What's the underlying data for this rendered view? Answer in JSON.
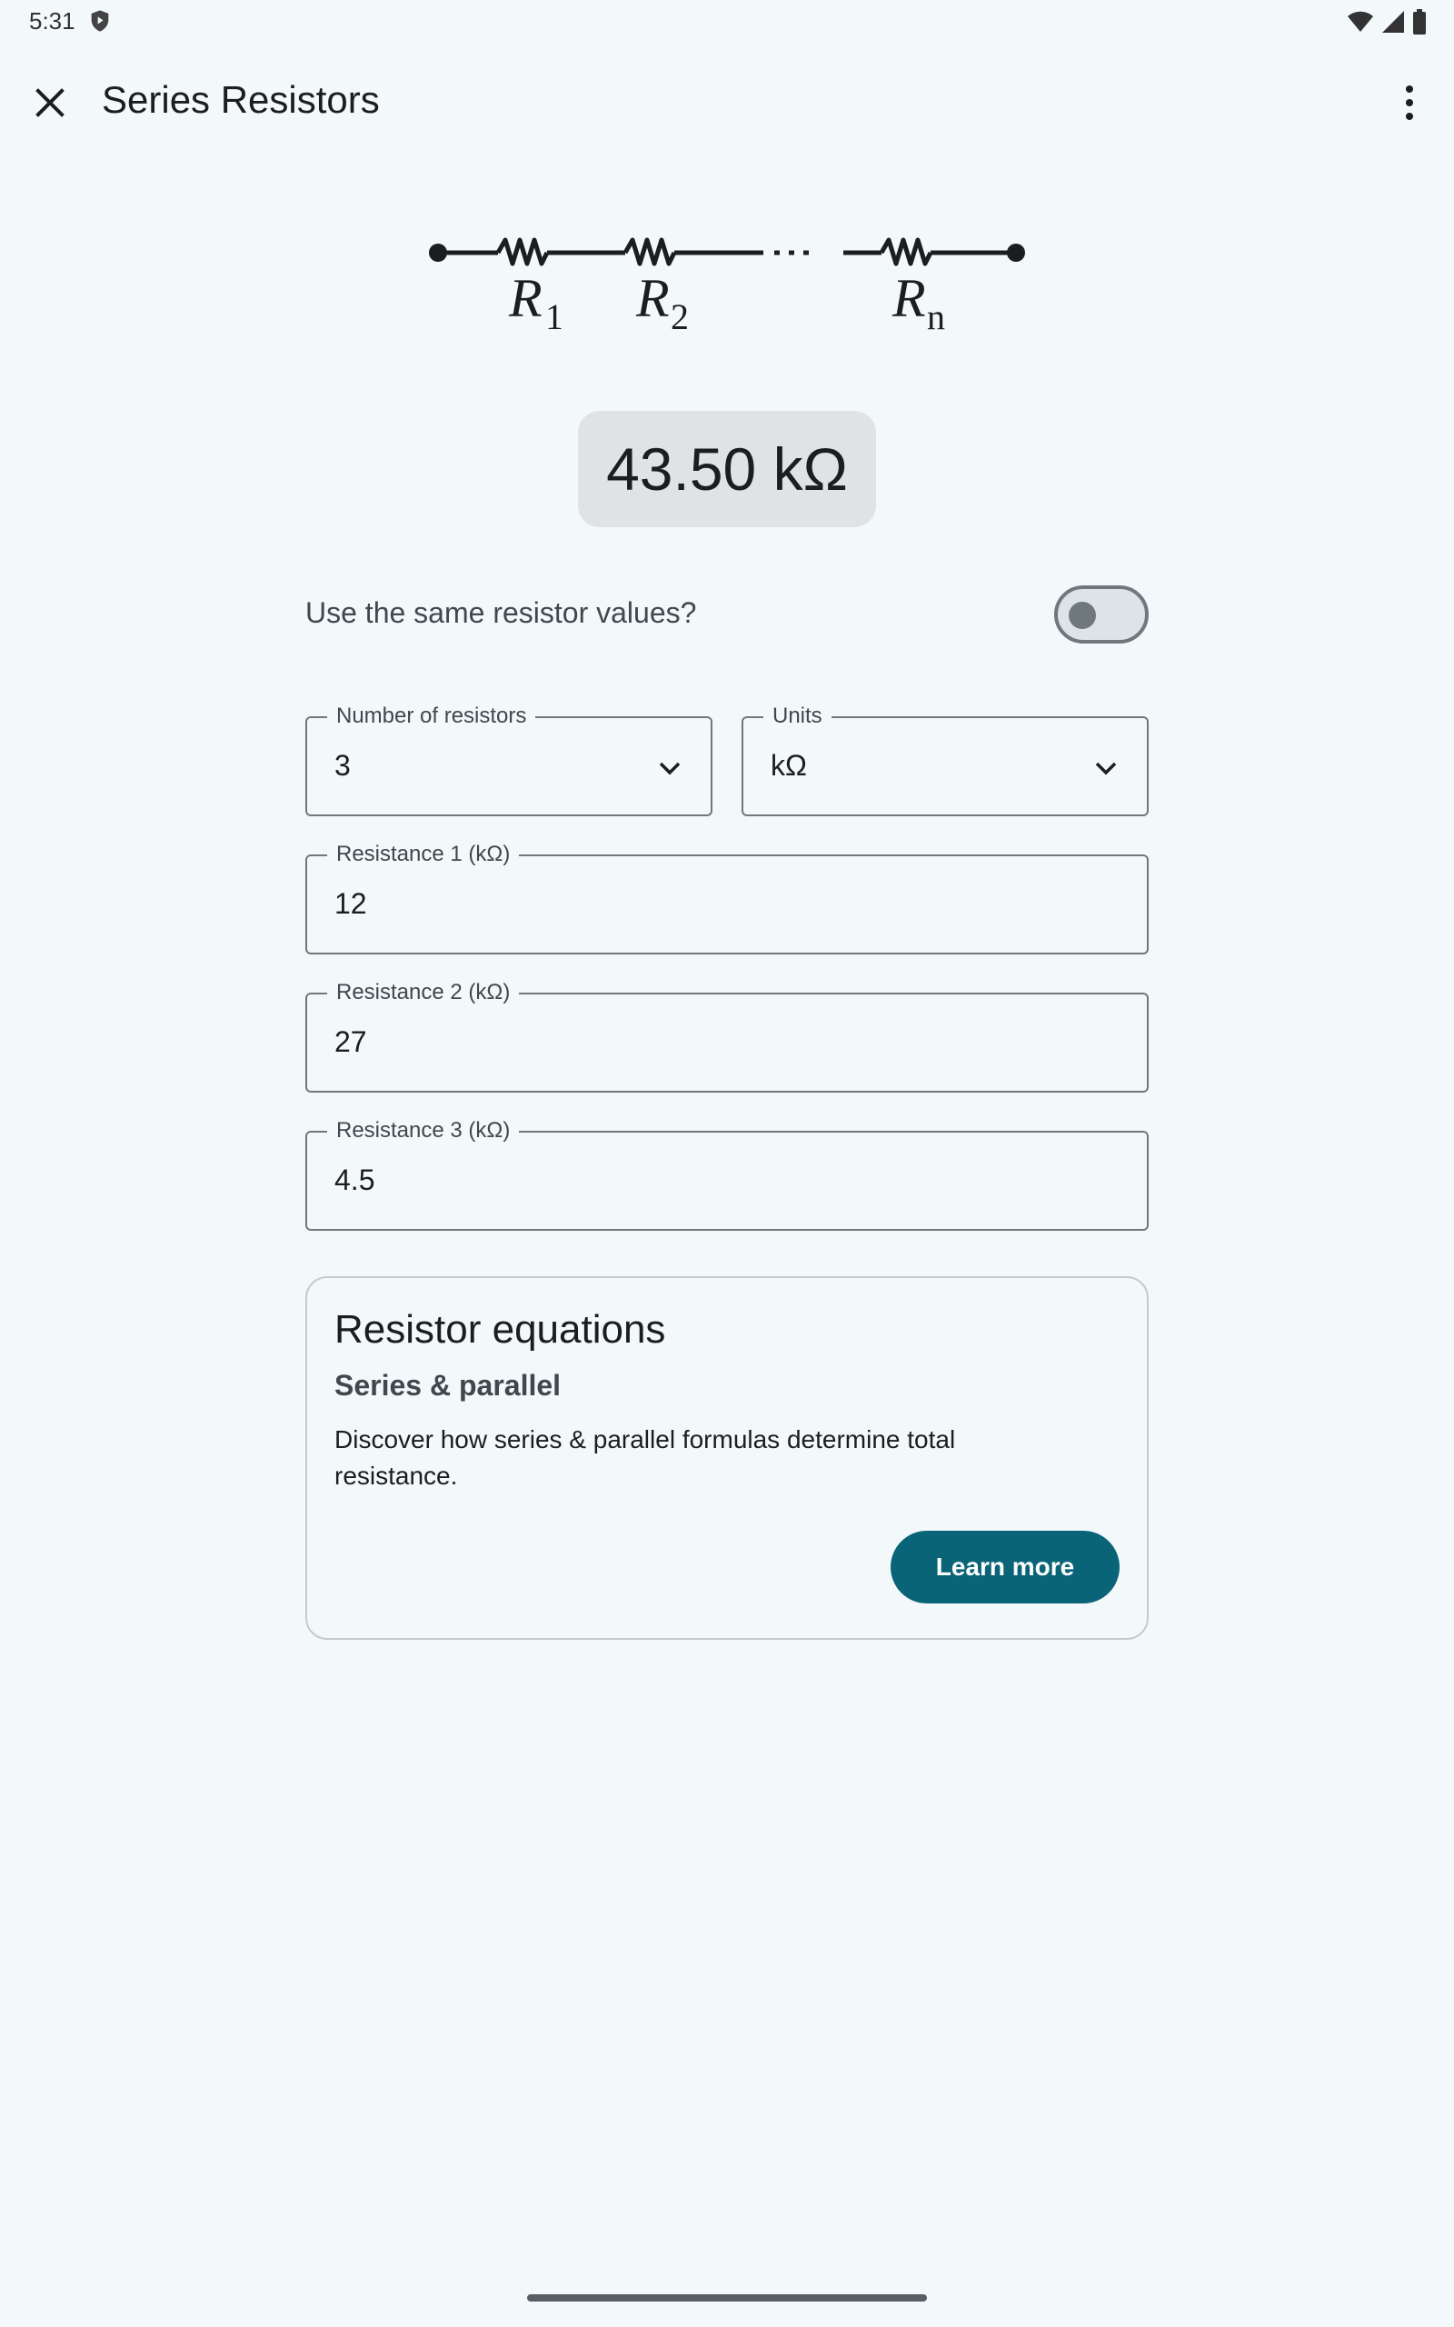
{
  "status_bar": {
    "time": "5:31"
  },
  "app_bar": {
    "title": "Series Resistors"
  },
  "diagram": {
    "labels": [
      "R",
      "R",
      "R"
    ],
    "subscripts": [
      "1",
      "2",
      "n"
    ]
  },
  "result": {
    "value": "43.50 kΩ"
  },
  "same_values": {
    "label": "Use the same resistor values?",
    "enabled": false
  },
  "fields": {
    "count": {
      "label": "Number of resistors",
      "value": "3"
    },
    "units": {
      "label": "Units",
      "value": "kΩ"
    },
    "resistances": [
      {
        "label": "Resistance 1 (kΩ)",
        "value": "12"
      },
      {
        "label": "Resistance 2 (kΩ)",
        "value": "27"
      },
      {
        "label": "Resistance 3 (kΩ)",
        "value": "4.5"
      }
    ]
  },
  "card": {
    "title": "Resistor equations",
    "subtitle": "Series & parallel",
    "body": "Discover how series & parallel formulas determine total resistance.",
    "button_label": "Learn more"
  },
  "colors": {
    "accent": "#0a6478",
    "background": "#f3f8fb",
    "chip": "#e0e3e5"
  }
}
